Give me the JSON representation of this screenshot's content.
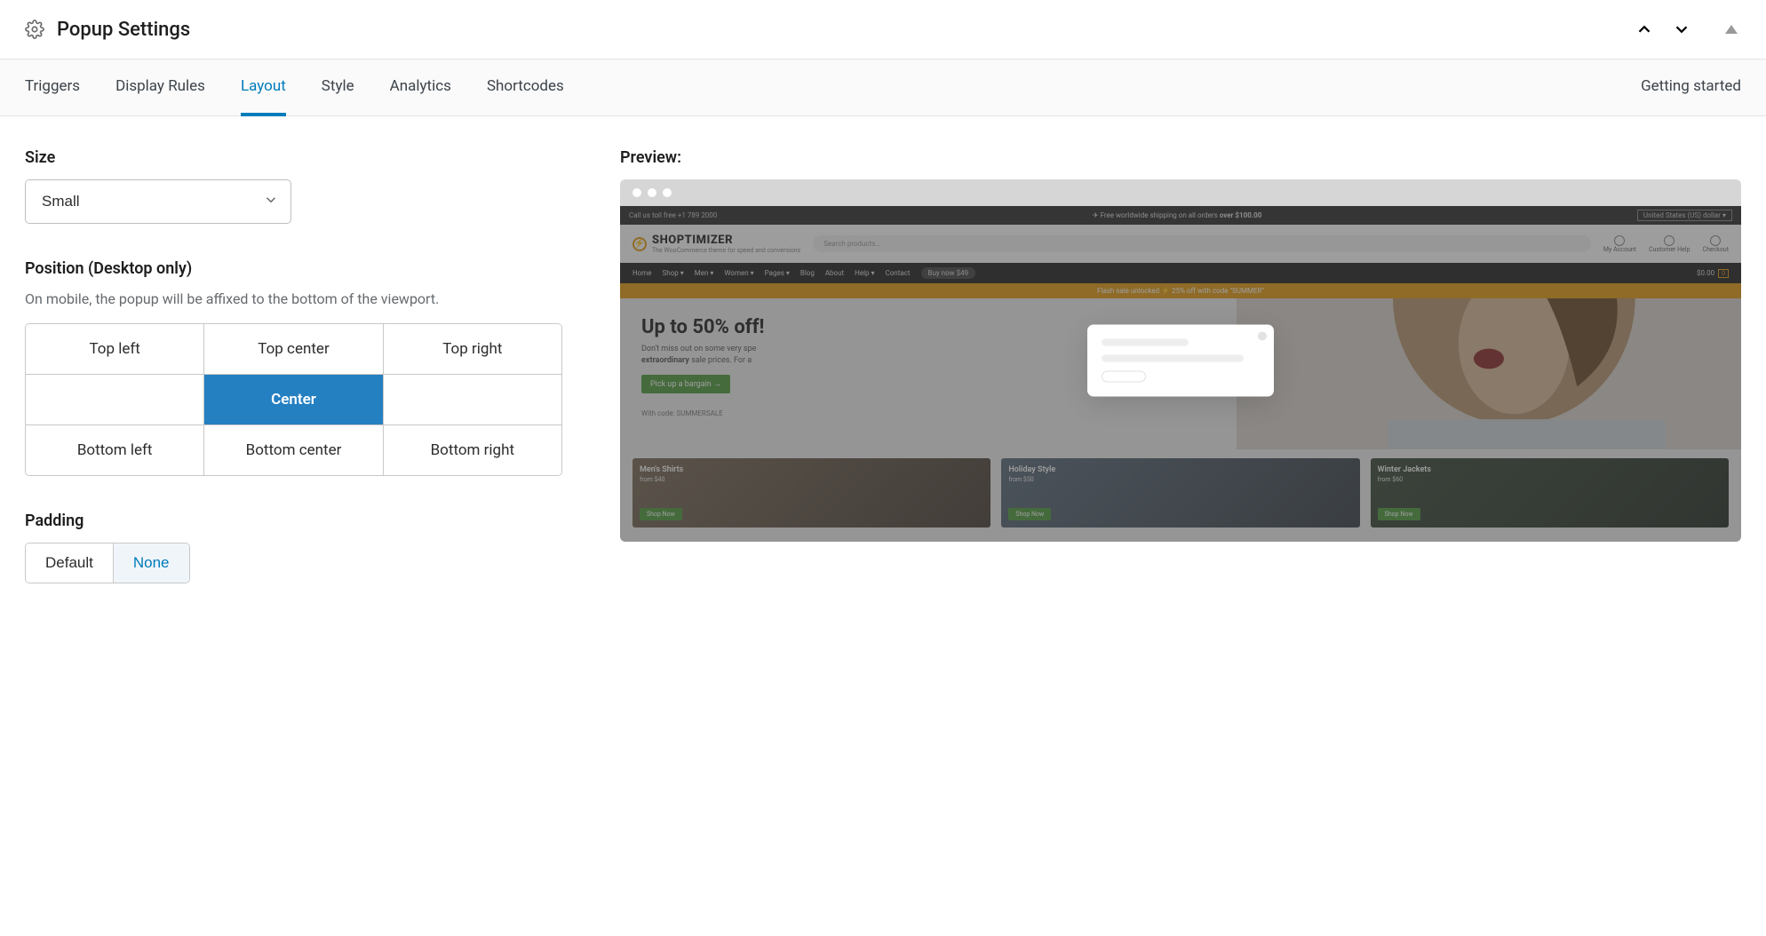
{
  "header": {
    "title": "Popup Settings"
  },
  "tabs": {
    "items": [
      "Triggers",
      "Display Rules",
      "Layout",
      "Style",
      "Analytics",
      "Shortcodes"
    ],
    "active_index": 2,
    "right_link": "Getting started"
  },
  "size": {
    "label": "Size",
    "selected": "Small"
  },
  "position": {
    "label": "Position (Desktop only)",
    "help": "On mobile, the popup will be affixed to the bottom of the viewport.",
    "grid": [
      [
        "Top left",
        "Top center",
        "Top right"
      ],
      [
        "",
        "Center",
        ""
      ],
      [
        "Bottom left",
        "Bottom center",
        "Bottom right"
      ]
    ],
    "selected": "Center"
  },
  "padding": {
    "label": "Padding",
    "options": [
      "Default",
      "None"
    ],
    "selected": "None"
  },
  "preview": {
    "label": "Preview:",
    "topbar": {
      "left": "Call us toll free +1 789 2000",
      "mid_prefix": "✈ Free worldwide shipping on all orders ",
      "mid_bold": "over $100.00",
      "currency": "United States (US) dollar ▾"
    },
    "logo": {
      "name": "SHOPTIMIZER",
      "tagline": "The WooCommerce theme for speed and conversions"
    },
    "search_placeholder": "Search products…",
    "header_icons": [
      "My Account",
      "Customer Help",
      "Checkout"
    ],
    "nav": {
      "items": [
        "Home",
        "Shop ▾",
        "Men ▾",
        "Women ▾",
        "Pages ▾",
        "Blog",
        "About",
        "Help ▾",
        "Contact"
      ],
      "buy": "Buy now $49",
      "cart_total": "$0.00",
      "cart_count": "0"
    },
    "promo": "Flash sale unlocked ⚡ 25% off with code \"SUMMER\"",
    "hero": {
      "headline": "Up to 50% off!",
      "line1_pre": "Don't miss out on some very spe",
      "line2_bold": "extraordinary",
      "line2_rest": " sale prices. For a",
      "button": "Pick up a bargain →",
      "code": "With code: SUMMERSALE"
    },
    "cards": [
      {
        "title": "Men's Shirts",
        "sub": "from $40",
        "btn": "Shop Now"
      },
      {
        "title": "Holiday Style",
        "sub": "from $50",
        "btn": "Shop Now"
      },
      {
        "title": "Winter Jackets",
        "sub": "from $60",
        "btn": "Shop Now"
      }
    ]
  }
}
